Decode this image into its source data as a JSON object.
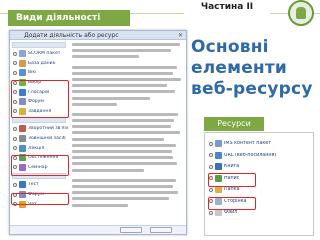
{
  "header": {
    "part_label": "Частина ІІ",
    "section_label": "Види діяльності"
  },
  "main_title": "Основні елементи веб-ресурсу",
  "resources_tab": "Ресурси",
  "colors": {
    "accent_green": "#7ea844",
    "title_blue": "#2e6aa6",
    "highlight_red": "#e0262b"
  },
  "dialog": {
    "title": "Додати діяльність або ресурс",
    "items": [
      {
        "label": "SCORM пакет",
        "icon": "package-icon"
      },
      {
        "label": "База даних",
        "icon": "database-icon"
      },
      {
        "label": "Вікі",
        "icon": "wiki-icon"
      },
      {
        "label": "Вибір",
        "icon": "choice-icon"
      },
      {
        "label": "Глосарій",
        "icon": "glossary-icon"
      },
      {
        "label": "Форум",
        "icon": "forum-icon"
      },
      {
        "label": "Завдання",
        "icon": "assignment-icon"
      },
      {
        "label": "Зворотний зв'язок",
        "icon": "feedback-icon"
      },
      {
        "label": "Зовнішній засіб",
        "icon": "external-tool-icon"
      },
      {
        "label": "Лекція",
        "icon": "lesson-icon"
      },
      {
        "label": "Обстеження",
        "icon": "survey-icon"
      },
      {
        "label": "Семінар",
        "icon": "workshop-icon"
      },
      {
        "label": "Тест",
        "icon": "quiz-icon"
      },
      {
        "label": "Форум",
        "icon": "forum-icon"
      },
      {
        "label": "Чат",
        "icon": "chat-icon"
      }
    ]
  },
  "resources": [
    {
      "label": "IMS контент пакет",
      "icon": "ims-package-icon"
    },
    {
      "label": "URL (веб-посилання)",
      "icon": "url-icon"
    },
    {
      "label": "Книга",
      "icon": "book-icon"
    },
    {
      "label": "Напис",
      "icon": "label-icon"
    },
    {
      "label": "Папка",
      "icon": "folder-icon"
    },
    {
      "label": "Сторінка",
      "icon": "page-icon"
    },
    {
      "label": "Файл",
      "icon": "file-icon"
    }
  ]
}
